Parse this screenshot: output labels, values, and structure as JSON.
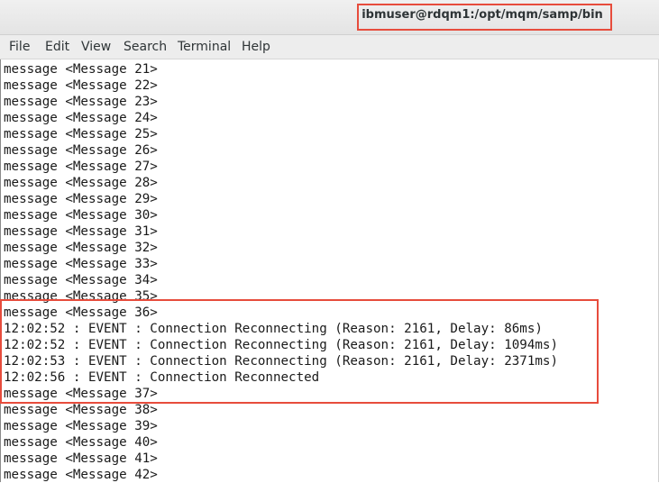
{
  "window": {
    "title": "ibmuser@rdqm1:/opt/mqm/samp/bin"
  },
  "menu": {
    "items": [
      "File",
      "Edit",
      "View",
      "Search",
      "Terminal",
      "Help"
    ]
  },
  "terminal": {
    "lines": [
      "message <Message 21>",
      "message <Message 22>",
      "message <Message 23>",
      "message <Message 24>",
      "message <Message 25>",
      "message <Message 26>",
      "message <Message 27>",
      "message <Message 28>",
      "message <Message 29>",
      "message <Message 30>",
      "message <Message 31>",
      "message <Message 32>",
      "message <Message 33>",
      "message <Message 34>",
      "message <Message 35>",
      "message <Message 36>",
      "12:02:52 : EVENT : Connection Reconnecting (Reason: 2161, Delay: 86ms)",
      "12:02:52 : EVENT : Connection Reconnecting (Reason: 2161, Delay: 1094ms)",
      "12:02:53 : EVENT : Connection Reconnecting (Reason: 2161, Delay: 2371ms)",
      "12:02:56 : EVENT : Connection Reconnected",
      "message <Message 37>",
      "message <Message 38>",
      "message <Message 39>",
      "message <Message 40>",
      "message <Message 41>",
      "message <Message 42>"
    ]
  },
  "colors": {
    "highlight": "#e74c3c"
  }
}
